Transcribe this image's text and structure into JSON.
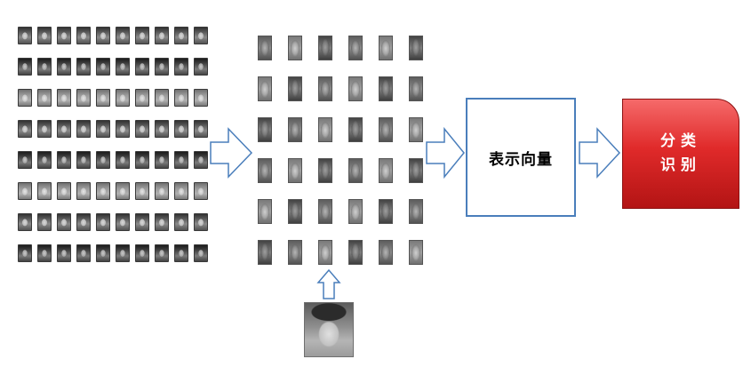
{
  "vector_box": {
    "label": "表示向量"
  },
  "classify_box": {
    "line1": "分类",
    "line2": "识别"
  },
  "training_faces": {
    "rows": 8,
    "cols": 10
  },
  "eigenfaces": {
    "rows": 6,
    "cols": 6
  },
  "colors": {
    "arrow_stroke": "#4a7ebb",
    "box_border": "#4a7ebb",
    "classify_fill": "#e02a2a"
  }
}
